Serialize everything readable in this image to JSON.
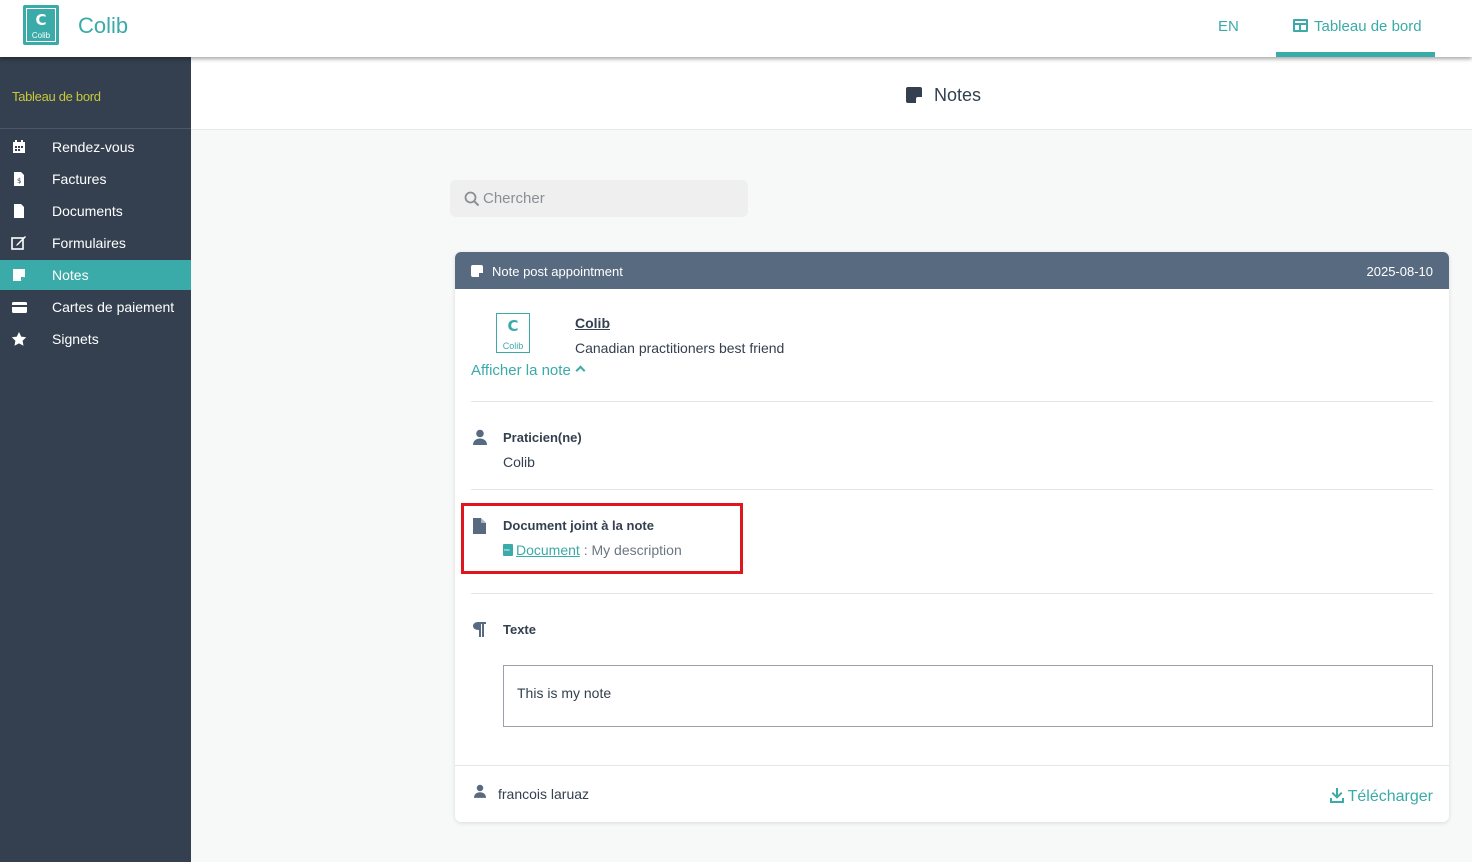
{
  "app": {
    "name": "Colib",
    "logo_text": "Colib",
    "logo_letter": "C"
  },
  "topbar": {
    "lang": "EN",
    "dashboard": "Tableau de bord"
  },
  "sidebar": {
    "title": "Tableau de bord",
    "items": [
      {
        "label": "Rendez-vous",
        "icon": "calendar-icon"
      },
      {
        "label": "Factures",
        "icon": "invoice-icon"
      },
      {
        "label": "Documents",
        "icon": "document-icon"
      },
      {
        "label": "Formulaires",
        "icon": "form-icon"
      },
      {
        "label": "Notes",
        "icon": "note-icon",
        "active": true
      },
      {
        "label": "Cartes de paiement",
        "icon": "credit-card-icon"
      },
      {
        "label": "Signets",
        "icon": "star-icon"
      }
    ]
  },
  "page": {
    "title": "Notes"
  },
  "search": {
    "placeholder": "Chercher"
  },
  "note": {
    "title": "Note post appointment",
    "date": "2025-08-10",
    "org_name": "Colib",
    "org_subtitle": "Canadian practitioners best friend",
    "toggle_label": "Afficher la note",
    "practitioner_label": "Praticien(ne)",
    "practitioner_value": "Colib",
    "attachment_label": "Document joint à la note",
    "attachment_link": "Document",
    "attachment_sep": " : ",
    "attachment_desc": "My description",
    "text_label": "Texte",
    "text_value": "This is my note",
    "author": "francois laruaz",
    "download_label": "Télécharger"
  },
  "colors": {
    "accent": "#3aaba8",
    "sidebar_bg": "#34404f",
    "card_header_bg": "#586a7f",
    "highlight": "#e0161e"
  }
}
